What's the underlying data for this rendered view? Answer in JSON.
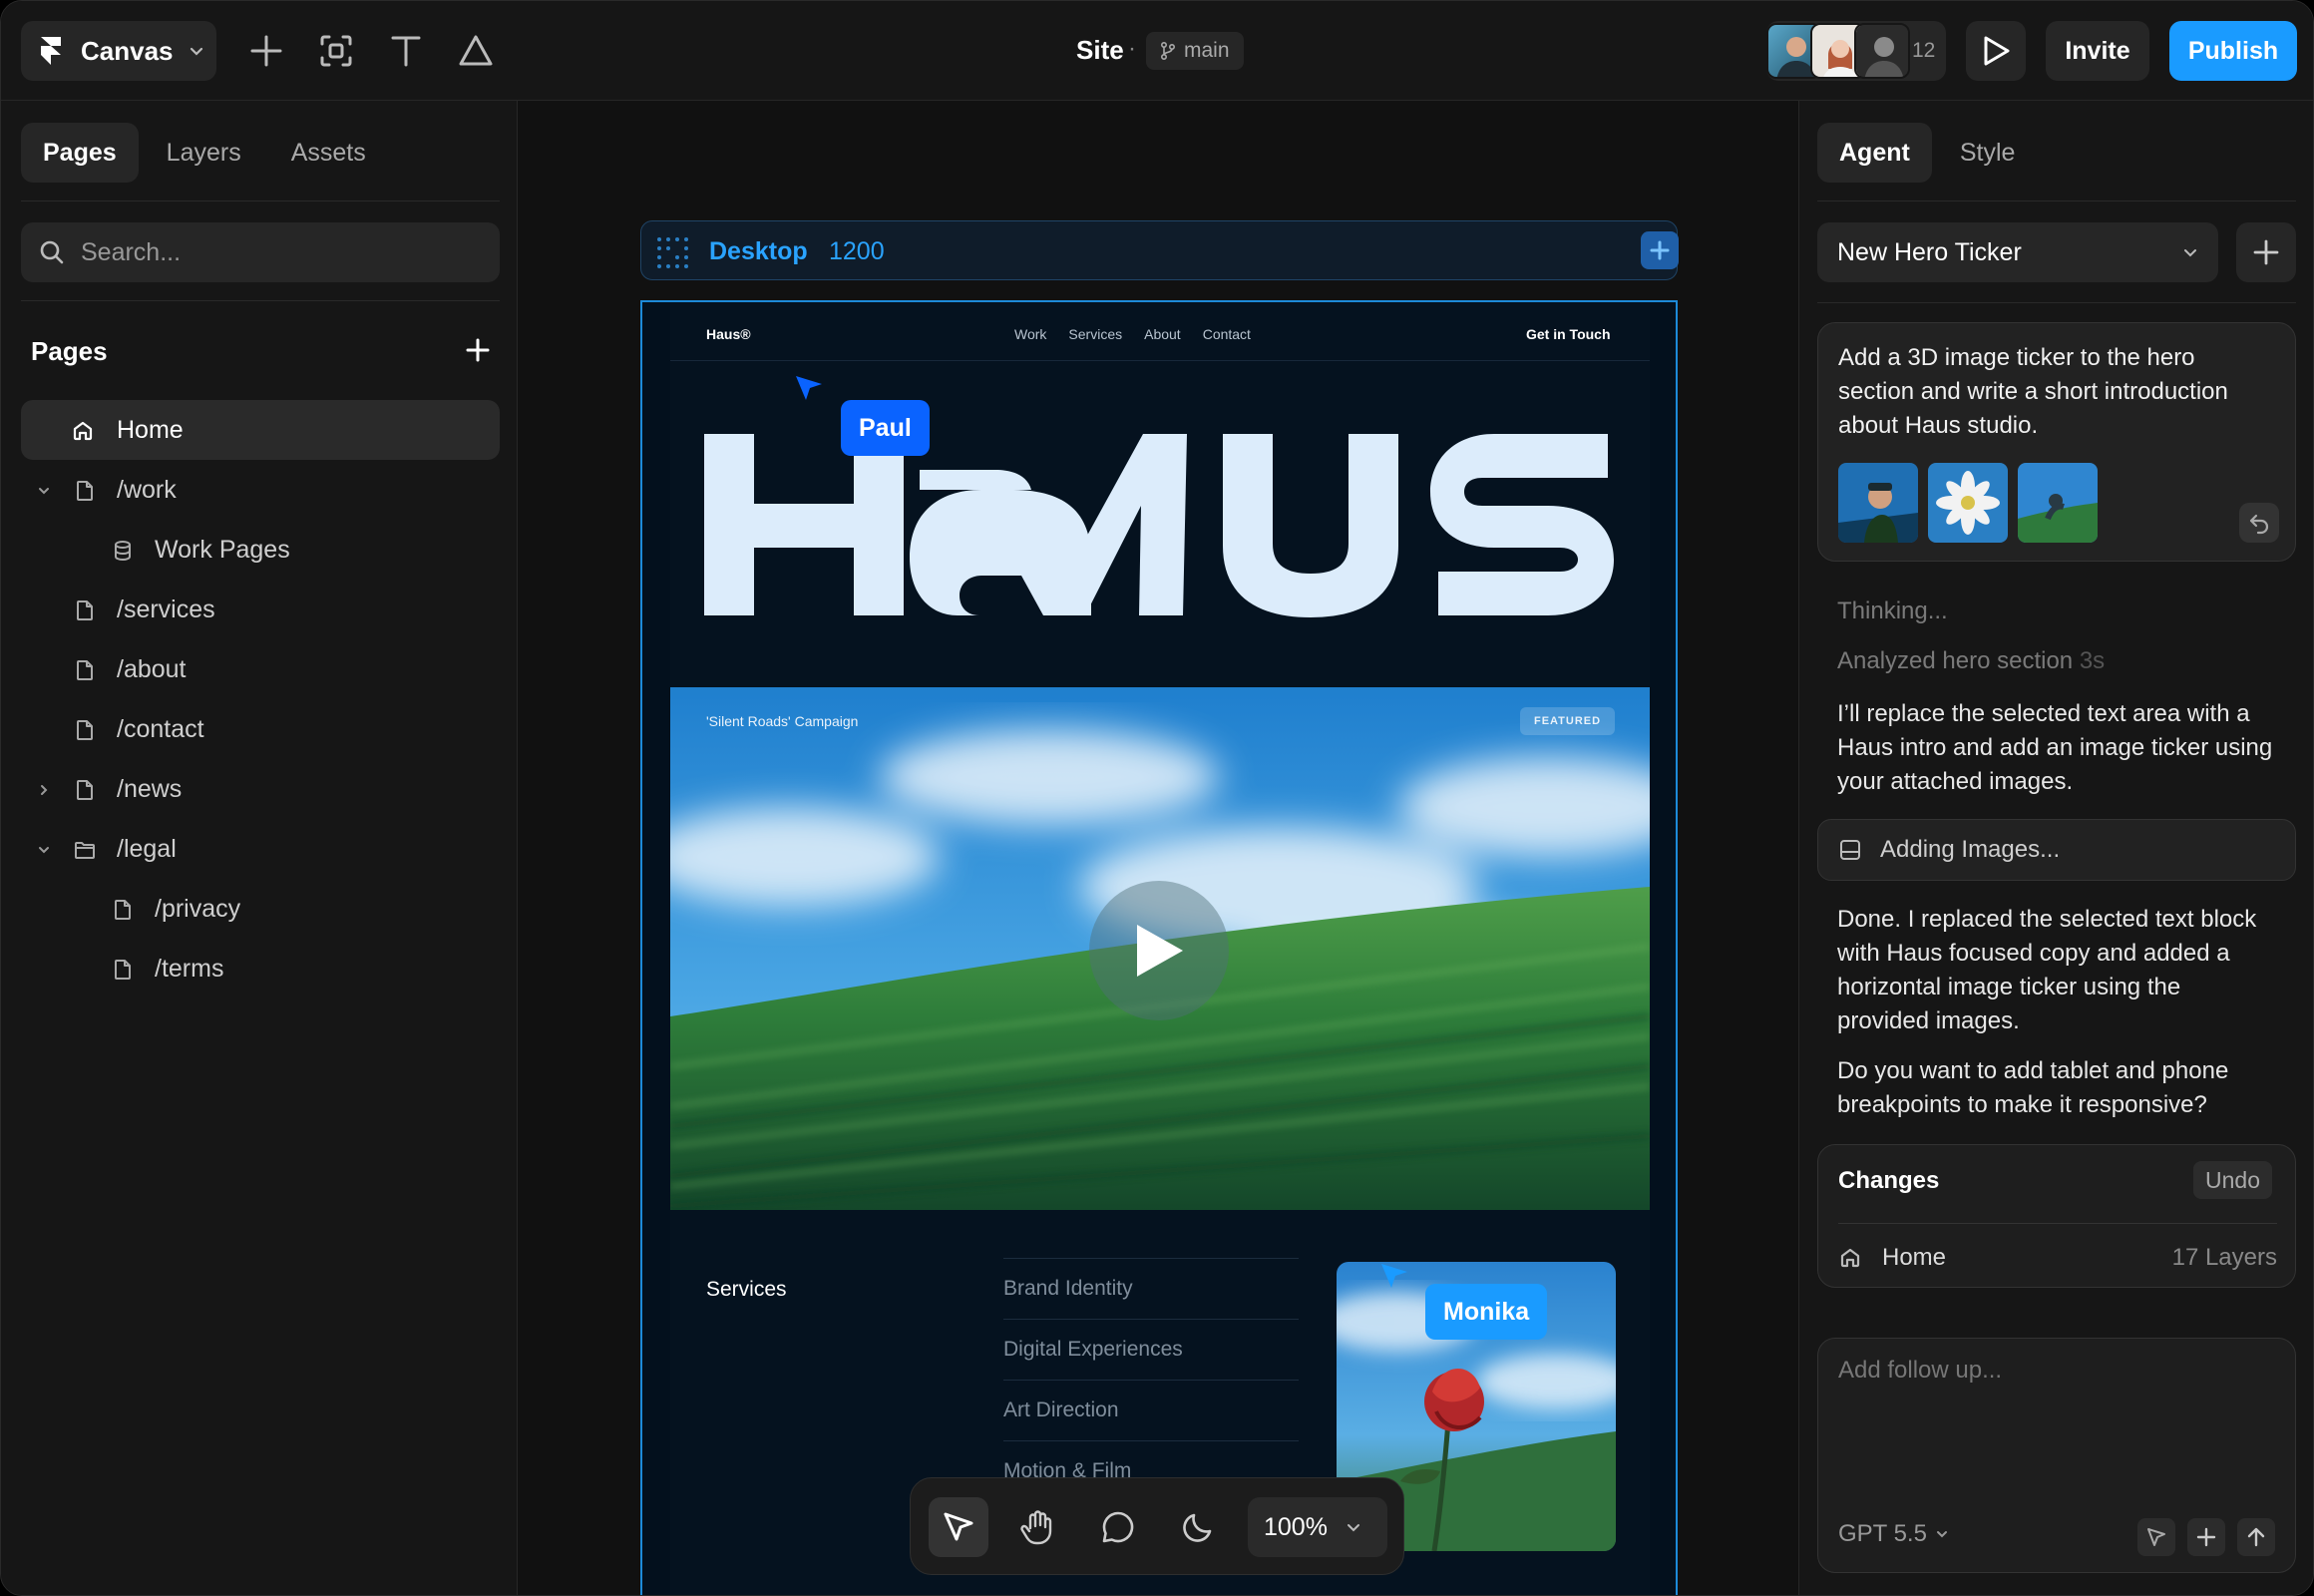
{
  "topbar": {
    "app_menu_label": "Canvas",
    "site_title": "Site",
    "separator": "·",
    "branch": "main",
    "collaborator_count": "12",
    "invite_label": "Invite",
    "publish_label": "Publish"
  },
  "left": {
    "tabs": [
      "Pages",
      "Layers",
      "Assets"
    ],
    "search_placeholder": "Search...",
    "section_title": "Pages",
    "pages": [
      {
        "label": "Home",
        "icon": "home-icon"
      },
      {
        "label": "/work",
        "icon": "page-icon"
      },
      {
        "label": "Work Pages",
        "icon": "database-icon"
      },
      {
        "label": "/services",
        "icon": "page-icon"
      },
      {
        "label": "/about",
        "icon": "page-icon"
      },
      {
        "label": "/contact",
        "icon": "page-icon"
      },
      {
        "label": "/news",
        "icon": "page-icon"
      },
      {
        "label": "/legal",
        "icon": "folder-icon"
      },
      {
        "label": "/privacy",
        "icon": "page-icon"
      },
      {
        "label": "/terms",
        "icon": "page-icon"
      }
    ]
  },
  "canvas": {
    "frame_name": "Desktop",
    "frame_width": "1200",
    "site": {
      "logo": "Haus®",
      "nav": [
        "Work",
        "Services",
        "About",
        "Contact"
      ],
      "cta": "Get in Touch",
      "hero_caption": "'Silent Roads' Campaign",
      "hero_badge": "FEATURED",
      "services_title": "Services",
      "services": [
        "Brand Identity",
        "Digital Experiences",
        "Art Direction",
        "Motion & Film"
      ]
    },
    "cursors": [
      {
        "name": "Paul",
        "color": "#0a63ff"
      },
      {
        "name": "Monika",
        "color": "#1a9bff"
      }
    ],
    "zoom": "100%"
  },
  "right": {
    "tabs": [
      "Agent",
      "Style"
    ],
    "thread_title": "New Hero Ticker",
    "prompt": "Add a 3D image ticker to the hero section and write a short introduction about Haus studio.",
    "status_thinking": "Thinking...",
    "status_analyzed": "Analyzed hero section",
    "status_analyzed_time": "3s",
    "msg1": "I’ll replace the selected text area with a Haus intro and add an image ticker using your attached images.",
    "tool_step": "Adding Images...",
    "msg2": "Done. I replaced the selected text block with Haus focused copy and added a horizontal image ticker using the provided images.",
    "msg3": "Do you want to add tablet and phone breakpoints to make it responsive?",
    "changes_title": "Changes",
    "changes_undo": "Undo",
    "changes_page": "Home",
    "changes_count": "17 Layers",
    "composer_placeholder": "Add follow up...",
    "model": "GPT 5.5"
  },
  "colors": {
    "accent": "#1a9bff",
    "background": "#111111",
    "panel": "#161616"
  }
}
